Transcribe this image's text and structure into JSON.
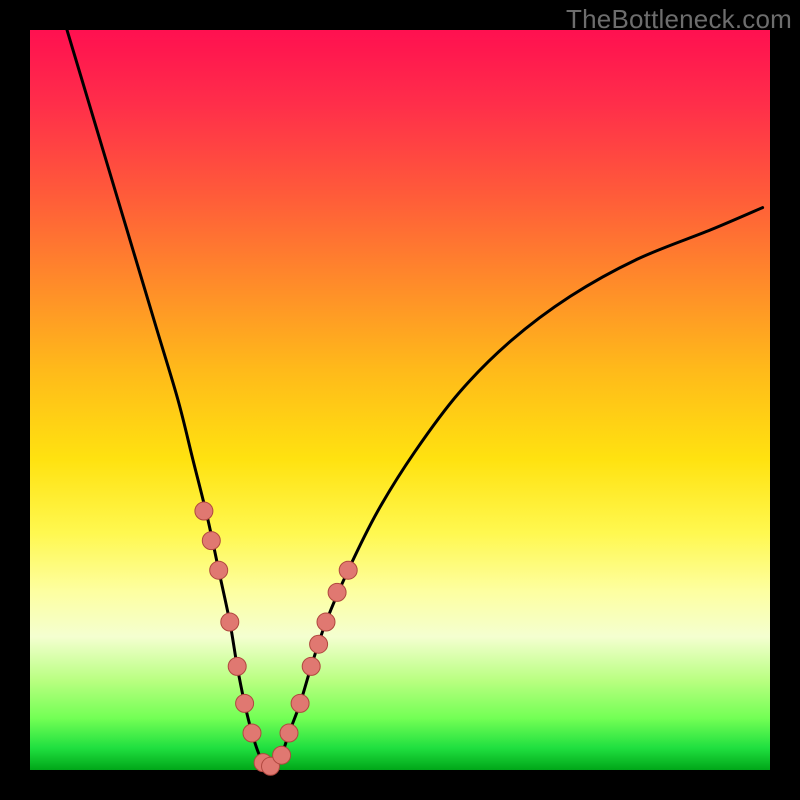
{
  "watermark": {
    "text": "TheBottleneck.com"
  },
  "colors": {
    "curve": "#000000",
    "dot_fill": "#e07871",
    "dot_stroke": "#b0483f"
  },
  "chart_data": {
    "type": "line",
    "title": "",
    "xlabel": "",
    "ylabel": "",
    "xlim": [
      0,
      100
    ],
    "ylim": [
      0,
      100
    ],
    "grid": false,
    "series": [
      {
        "name": "bottleneck-curve",
        "x": [
          5,
          8,
          11,
          14,
          17,
          20,
          22,
          24,
          25.5,
          27,
          28,
          29,
          30,
          31,
          32,
          33,
          34,
          35,
          36.5,
          38,
          40,
          43,
          47,
          52,
          58,
          65,
          73,
          82,
          92,
          99
        ],
        "values": [
          100,
          90,
          80,
          70,
          60,
          50,
          42,
          34,
          27,
          20,
          14,
          9,
          5,
          2,
          0.5,
          0.5,
          2,
          5,
          9,
          14,
          20,
          27,
          35,
          43,
          51,
          58,
          64,
          69,
          73,
          76
        ]
      }
    ],
    "highlighted_points": {
      "name": "curve-dots",
      "x": [
        23.5,
        24.5,
        25.5,
        27.0,
        28.0,
        29.0,
        30.0,
        31.5,
        32.5,
        34.0,
        35.0,
        36.5,
        38.0,
        39.0,
        40.0,
        41.5,
        43.0
      ],
      "values": [
        35,
        31,
        27,
        20,
        14,
        9,
        5,
        1,
        0.5,
        2,
        5,
        9,
        14,
        17,
        20,
        24,
        27
      ]
    }
  }
}
